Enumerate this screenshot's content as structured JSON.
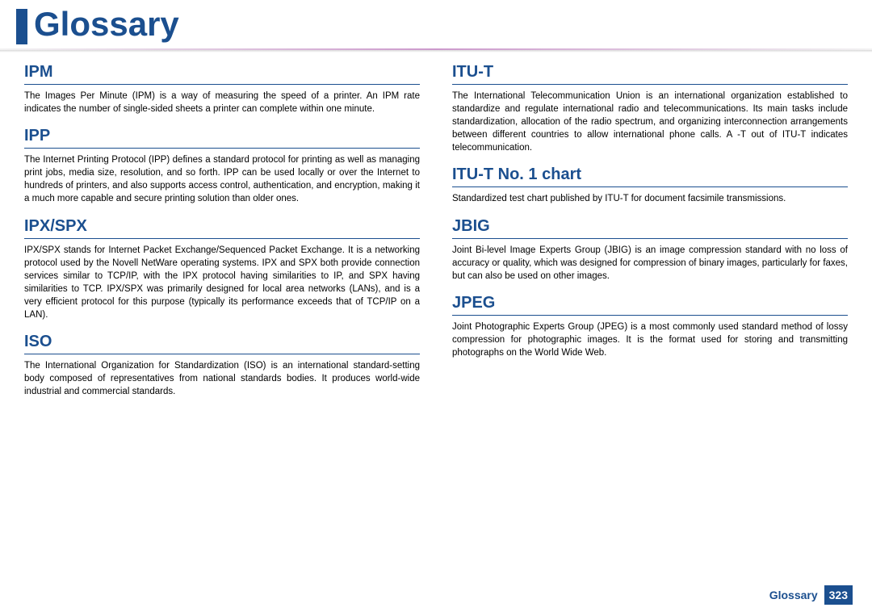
{
  "page": {
    "title": "Glossary",
    "footer_label": "Glossary",
    "footer_page": "323"
  },
  "left": [
    {
      "title": "IPM",
      "body": "The Images Per Minute (IPM) is a way of measuring the speed of a printer. An IPM rate indicates the number of single-sided sheets a printer can complete within one minute."
    },
    {
      "title": "IPP",
      "body": "The Internet Printing Protocol (IPP) defines a standard protocol for printing as well as managing print jobs, media size, resolution, and so forth. IPP can be used locally or over the Internet to hundreds of printers, and also supports access control, authentication, and encryption, making it a much more capable and secure printing solution than older ones."
    },
    {
      "title": "IPX/SPX",
      "body": "IPX/SPX stands for Internet Packet Exchange/Sequenced Packet Exchange. It is a networking protocol used by the Novell NetWare operating systems. IPX and SPX both provide connection services similar to TCP/IP, with the IPX protocol having similarities to IP, and SPX having similarities to TCP. IPX/SPX was primarily designed for local area networks (LANs), and is a very efficient protocol for this purpose (typically its performance exceeds that of TCP/IP on a LAN)."
    },
    {
      "title": "ISO",
      "body": "The International Organization for Standardization (ISO) is an international standard-setting body composed of representatives from national standards bodies. It produces world-wide industrial and commercial standards."
    }
  ],
  "right": [
    {
      "title": "ITU-T",
      "body": "The International Telecommunication Union is an international organization established to standardize and regulate international radio and telecommunications. Its main tasks include standardization, allocation of the radio spectrum, and organizing interconnection arrangements between different countries to allow international phone calls. A -T out of ITU-T indicates telecommunication."
    },
    {
      "title": "ITU-T No. 1 chart",
      "body": "Standardized test chart published by ITU-T for document facsimile transmissions."
    },
    {
      "title": "JBIG",
      "body": "Joint Bi-level Image Experts Group (JBIG) is an image compression standard with no loss of accuracy or quality, which was designed for compression of binary images, particularly for faxes, but can also be used on other images."
    },
    {
      "title": "JPEG",
      "body": "Joint Photographic Experts Group (JPEG) is a most commonly used standard method of lossy compression for photographic images. It is the format used for storing and transmitting photographs on the World Wide Web."
    }
  ]
}
